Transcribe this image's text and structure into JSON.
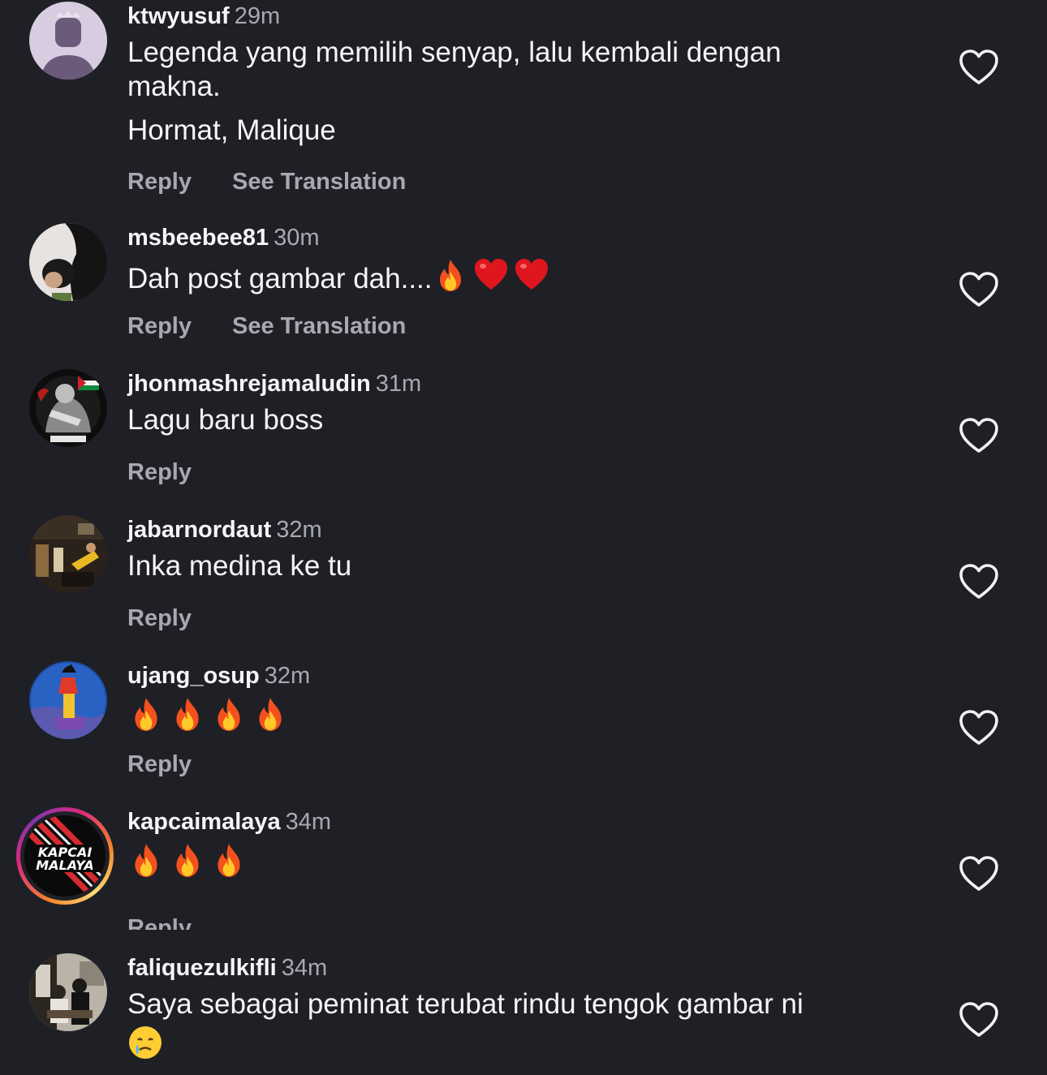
{
  "comments": [
    {
      "username": "ktwyusuf",
      "time": "29m",
      "text1": "Legenda yang memilih senyap, lalu kembali dengan makna.",
      "text2": "Hormat, Malique",
      "reply": "Reply",
      "translation": "See Translation"
    },
    {
      "username": "msbeebee81",
      "time": "30m",
      "text": "Dah post gambar dah....",
      "emojis": [
        "fire",
        "heart",
        "heart"
      ],
      "reply": "Reply",
      "translation": "See Translation"
    },
    {
      "username": "jhonmashrejamaludin",
      "time": "31m",
      "text": "Lagu baru boss",
      "reply": "Reply"
    },
    {
      "username": "jabarnordaut",
      "time": "32m",
      "text": "Inka medina ke tu",
      "reply": "Reply"
    },
    {
      "username": "ujang_osup",
      "time": "32m",
      "emojis": [
        "fire",
        "fire",
        "fire",
        "fire"
      ],
      "reply": "Reply"
    },
    {
      "username": "kapcaimalaya",
      "time": "34m",
      "emojis": [
        "fire",
        "fire",
        "fire"
      ],
      "reply": "Reply",
      "avatar_text1": "KAPCAI",
      "avatar_text2": "MALAYA"
    },
    {
      "username": "faliquezulkifli",
      "time": "34m",
      "text": "Saya sebagai peminat terubat rindu tengok gambar ni",
      "emojis": [
        "sad-tear"
      ]
    }
  ],
  "colors": {
    "background": "#1f2026",
    "text": "#f5f5f7",
    "secondary": "#a8a9b0"
  }
}
